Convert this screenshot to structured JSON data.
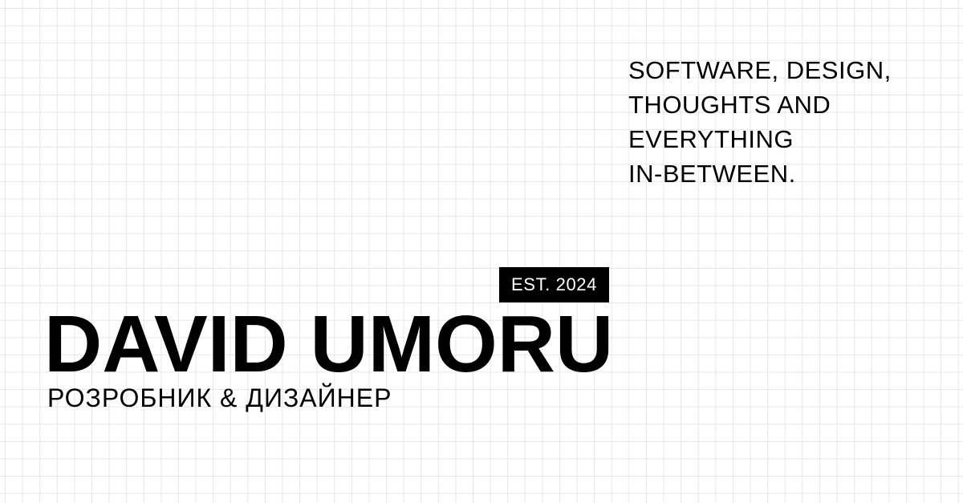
{
  "tagline": {
    "lines": [
      "SOFTWARE, DESIGN,",
      "THOUGHTS AND",
      "EVERYTHING",
      "IN-BETWEEN."
    ]
  },
  "badge": {
    "label": "EST. 2024"
  },
  "name": "DAVID UMORU",
  "role": "РОЗРОБНИК & ДИЗАЙНЕР",
  "colors": {
    "background": "#ffffff",
    "grid": "#e6e6e6",
    "text": "#000000",
    "badge_bg": "#000000",
    "badge_text": "#ffffff"
  }
}
